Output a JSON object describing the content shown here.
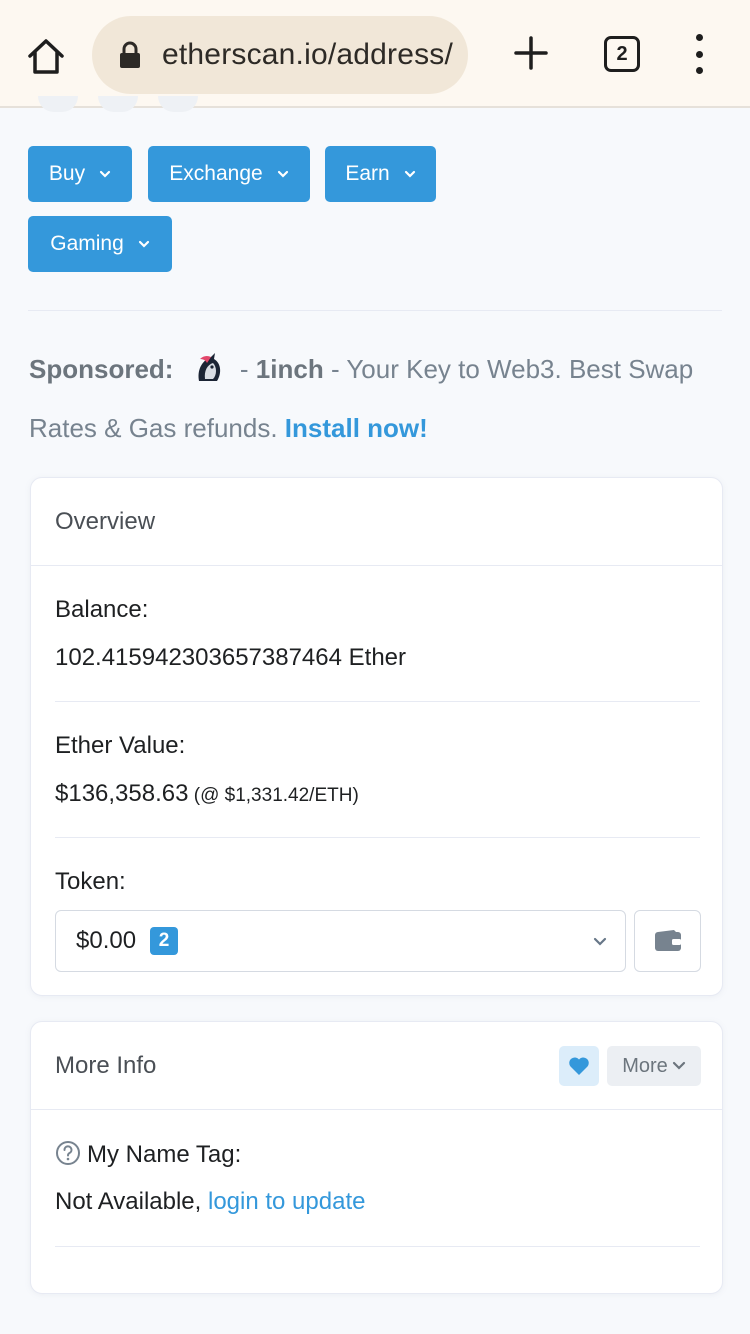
{
  "browser": {
    "url": "etherscan.io/address/",
    "tab_count": "2"
  },
  "nav_buttons": {
    "buy": "Buy",
    "exchange": "Exchange",
    "earn": "Earn",
    "gaming": "Gaming"
  },
  "sponsored": {
    "label": "Sponsored:",
    "sep": " - ",
    "brand": "1inch",
    "text": " - Your Key to Web3. Best Swap Rates & Gas refunds. ",
    "cta": "Install now!"
  },
  "overview": {
    "title": "Overview",
    "balance_label": "Balance:",
    "balance_value": "102.415942303657387464 Ether",
    "ether_value_label": "Ether Value:",
    "ether_value": "$136,358.63",
    "ether_rate": " (@ $1,331.42/ETH)",
    "token_label": "Token:",
    "token_value": "$0.00",
    "token_count": "2"
  },
  "more_info": {
    "title": "More Info",
    "more_label": "More",
    "name_tag_label": "My Name Tag:",
    "name_tag_value": "Not Available, ",
    "name_tag_link": "login to update"
  },
  "colors": {
    "accent": "#3498db",
    "chrome_bg": "#fdf8f1",
    "urlbar_bg": "#f1e7d8"
  },
  "icons": {
    "home": "home-icon",
    "lock": "lock-icon",
    "plus": "plus-icon",
    "menu": "more-vert-icon",
    "wallet": "wallet-icon",
    "heart": "heart-icon",
    "help": "question-circle-icon"
  }
}
